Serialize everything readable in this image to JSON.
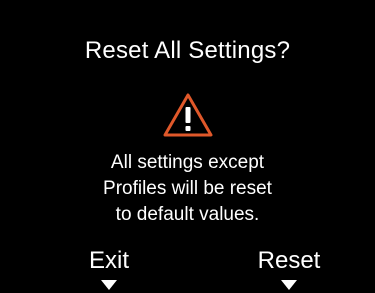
{
  "dialog": {
    "title": "Reset All Settings?",
    "icon": "warning-triangle-icon",
    "message_lines": [
      "All settings except",
      "Profiles will be reset",
      "to default values."
    ]
  },
  "softkeys": {
    "left_label": "Exit",
    "right_label": "Reset"
  },
  "colors": {
    "background": "#000000",
    "text": "#ffffff",
    "warning_accent": "#e0582a"
  }
}
